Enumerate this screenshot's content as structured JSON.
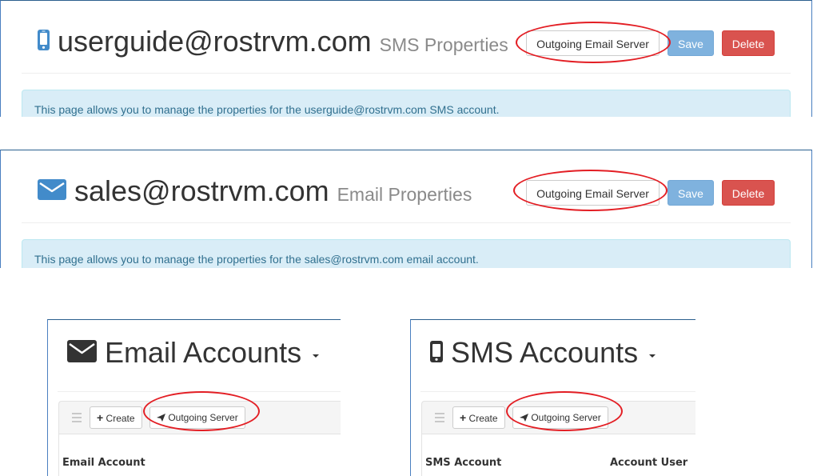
{
  "sms_properties_panel": {
    "icon": "mobile-phone-icon",
    "title": "userguide@rostrvm.com",
    "subtitle": "SMS Properties",
    "buttons": {
      "outgoing": "Outgoing Email Server",
      "save": "Save",
      "delete": "Delete"
    },
    "info": "This page allows you to manage the properties for the userguide@rostrvm.com SMS account."
  },
  "email_properties_panel": {
    "icon": "envelope-icon",
    "title": "sales@rostrvm.com",
    "subtitle": "Email Properties",
    "buttons": {
      "outgoing": "Outgoing Email Server",
      "save": "Save",
      "delete": "Delete"
    },
    "info": "This page allows you to manage the properties for the sales@rostrvm.com email account."
  },
  "email_accounts_panel": {
    "icon": "envelope-icon",
    "title": "Email Accounts",
    "toolbar": {
      "menu_icon": "hamburger-icon",
      "create": "Create",
      "create_icon": "plus-icon",
      "outgoing": "Outgoing Server",
      "outgoing_icon": "paper-plane-icon"
    },
    "columns": [
      "Email Account"
    ]
  },
  "sms_accounts_panel": {
    "icon": "mobile-phone-icon",
    "title": "SMS Accounts",
    "toolbar": {
      "menu_icon": "hamburger-icon",
      "create": "Create",
      "create_icon": "plus-icon",
      "outgoing": "Outgoing Server",
      "outgoing_icon": "paper-plane-icon"
    },
    "columns": [
      "SMS Account",
      "Account User"
    ]
  },
  "colors": {
    "accent_blue": "#428bca",
    "highlight_ellipse": "#e31e24",
    "save": "#7fb2de",
    "delete": "#d9534f",
    "info_bg": "#d9edf7"
  }
}
